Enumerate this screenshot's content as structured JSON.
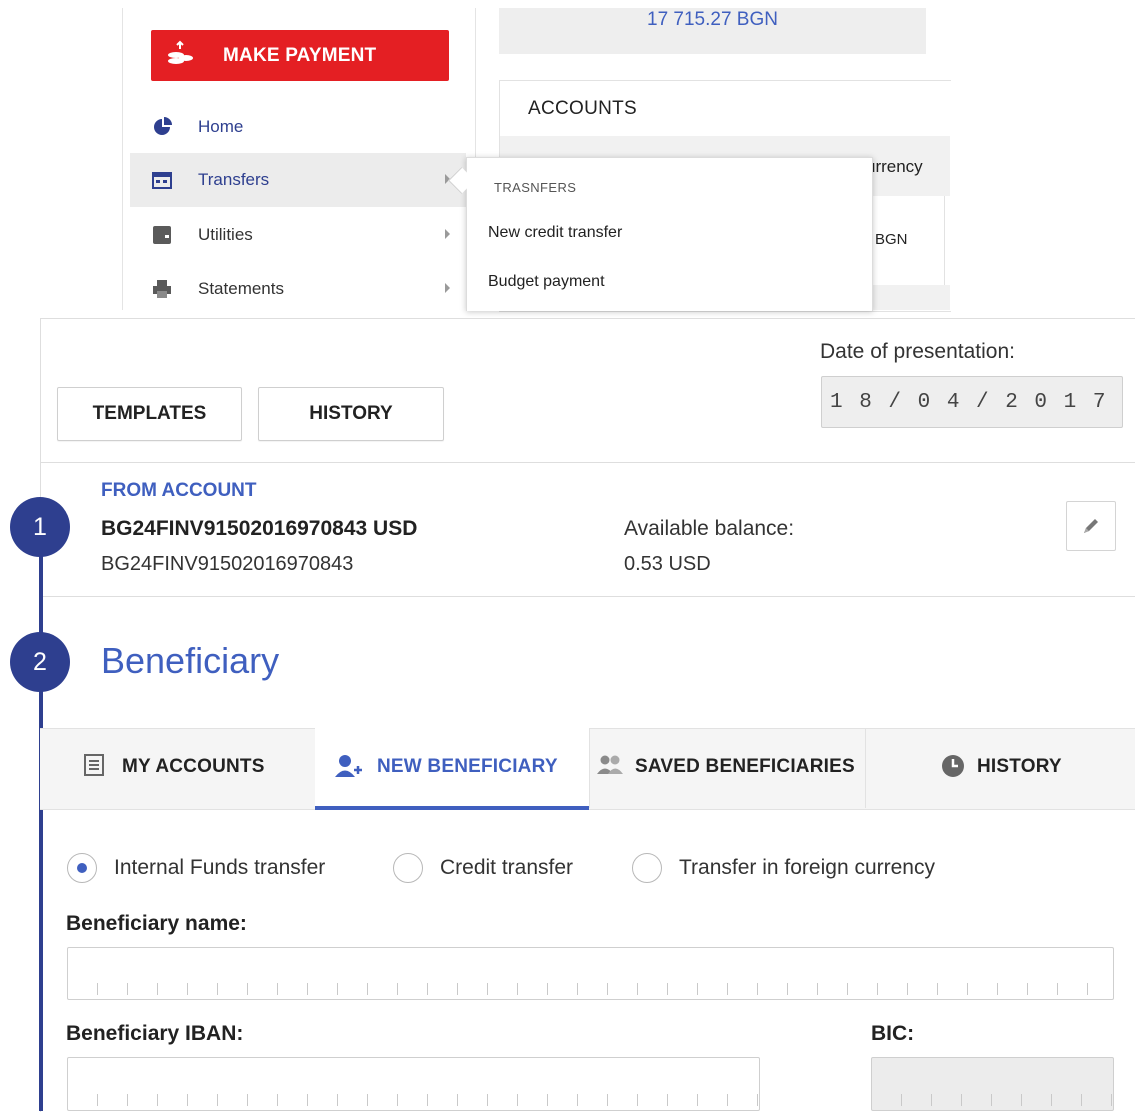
{
  "sidebar": {
    "make_payment": "MAKE PAYMENT",
    "items": [
      {
        "label": "Home",
        "icon": "pie-chart-icon"
      },
      {
        "label": "Transfers",
        "icon": "transfers-icon"
      },
      {
        "label": "Utilities",
        "icon": "utilities-icon"
      },
      {
        "label": "Statements",
        "icon": "printer-icon"
      }
    ]
  },
  "balance": "17 715.27 BGN",
  "accounts": {
    "title": "ACCOUNTS",
    "column_partial": "urrency",
    "cell_partial": "BGN"
  },
  "dropdown": {
    "header": "TRASNFERS",
    "items": [
      "New credit transfer",
      "Budget payment"
    ]
  },
  "toolbar": {
    "templates": "TEMPLATES",
    "history": "HISTORY",
    "date_label": "Date of presentation:",
    "date_value": "1 8 / 0 4 / 2 0 1 7"
  },
  "steps": [
    "1",
    "2"
  ],
  "from_account": {
    "label": "FROM ACCOUNT",
    "account_with_currency": "BG24FINV91502016970843 USD",
    "account": "BG24FINV91502016970843",
    "balance_label": "Available balance:",
    "balance_value": "0.53 USD"
  },
  "beneficiary": {
    "title": "Beneficiary",
    "tabs": [
      {
        "label": "MY ACCOUNTS",
        "icon": "list-icon"
      },
      {
        "label": "NEW BENEFICIARY",
        "icon": "add-user-icon",
        "active": true
      },
      {
        "label": "SAVED BENEFICIARIES",
        "icon": "users-icon"
      },
      {
        "label": "HISTORY",
        "icon": "clock-icon"
      }
    ],
    "transfer_types": [
      {
        "label": "Internal Funds transfer",
        "selected": true
      },
      {
        "label": "Credit transfer",
        "selected": false
      },
      {
        "label": "Transfer in foreign currency",
        "selected": false
      }
    ],
    "name_label": "Beneficiary name:",
    "iban_label": "Beneficiary IBAN:",
    "bic_label": "BIC:"
  },
  "colors": {
    "brand_red": "#e41f23",
    "accent_blue": "#3f5fbf",
    "step_navy": "#2e3f8f"
  }
}
